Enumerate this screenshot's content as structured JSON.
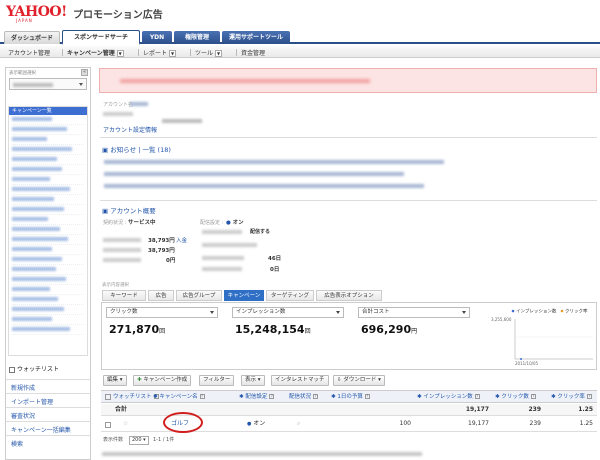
{
  "header": {
    "logo": "YAHOO!",
    "logo_sub": "JAPAN",
    "title": "プロモーション広告"
  },
  "main_tabs": [
    {
      "label": "ダッシュボード"
    },
    {
      "label": "スポンサードサーチ"
    },
    {
      "label": "YDN"
    },
    {
      "label": "権限管理"
    },
    {
      "label": "運用サポートツール"
    }
  ],
  "subnav": {
    "items": [
      {
        "label": "アカウント管理"
      },
      {
        "label": "キャンペーン管理"
      },
      {
        "label": "レポート"
      },
      {
        "label": "ツール"
      },
      {
        "label": "資金管理"
      }
    ]
  },
  "sidebar": {
    "heading": "表示範囲選択",
    "tree_selected": "キャンペーン一覧",
    "watch_label": "ウォッチリスト",
    "links": [
      {
        "label": "新規作成"
      },
      {
        "label": "インポート管理"
      },
      {
        "label": "審査状況"
      },
      {
        "label": "キャンペーン一括編集"
      },
      {
        "label": "検索"
      }
    ]
  },
  "account": {
    "name_label": "アカウント名",
    "info_link": "アカウント設定情報"
  },
  "news": {
    "title": "お知らせ",
    "list_link": "一覧 (18)"
  },
  "overview": {
    "title": "アカウント概要",
    "status_label": "契約状況 :",
    "status_value": "サービス中",
    "delivery_label": "配信設定 :",
    "delivery_value": "オン",
    "delivering": "配信する",
    "balance_rows": [
      {
        "value": "38,793円",
        "link": "入金"
      },
      {
        "value": "38,793円"
      },
      {
        "value": "0円"
      }
    ],
    "days_rows": [
      {
        "value": "46日"
      },
      {
        "value": "0日"
      }
    ]
  },
  "summary_tabs": {
    "caption": "表示内容選択",
    "tabs": [
      {
        "label": "キーワード"
      },
      {
        "label": "広告"
      },
      {
        "label": "広告グループ"
      },
      {
        "label": "キャンペーン",
        "active": true
      },
      {
        "label": "ターゲティング"
      },
      {
        "label": "広告表示オプション"
      }
    ]
  },
  "metrics": [
    {
      "label": "クリック数",
      "value": "271,870",
      "unit": "回"
    },
    {
      "label": "インプレッション数",
      "value": "15,248,154",
      "unit": "回"
    },
    {
      "label": "合計コスト",
      "value": "696,290",
      "unit": "円"
    }
  ],
  "chart_data": {
    "type": "line",
    "legend": [
      "インプレッション数",
      "クリック率"
    ],
    "y_tick_label": "3,255,600",
    "x_tick_label": "2011/10/05",
    "legend_position": "top-right"
  },
  "toolbar": [
    {
      "label": "編集"
    },
    {
      "label": "キャンペーン作成"
    },
    {
      "label": "フィルター"
    },
    {
      "label": "表示"
    },
    {
      "label": "インタレストマッチ"
    },
    {
      "label": "ダウンロード"
    }
  ],
  "table": {
    "headers": [
      "ウォッチリスト",
      "キャンペーン名",
      "配信設定",
      "配信状況",
      "1日の予算",
      "インプレッション数",
      "クリック数",
      "クリック率"
    ],
    "total": {
      "label": "合計",
      "impressions": "19,177",
      "clicks": "239",
      "ctr": "1.25"
    },
    "rows": [
      {
        "name": "ゴルフ",
        "delivery": "オン",
        "budget": "100",
        "impressions": "19,177",
        "clicks": "239",
        "ctr": "1.25"
      }
    ],
    "pager_label": "表示件数",
    "pager_value": "200",
    "pager_range": "1-1 / 1件"
  },
  "colors": {
    "brand_red": "#e0202b",
    "nav_blue": "#2b4f8a",
    "tab_active": "#2f6fc6",
    "highlight_ring": "#d21d1d",
    "link": "#2255aa"
  }
}
